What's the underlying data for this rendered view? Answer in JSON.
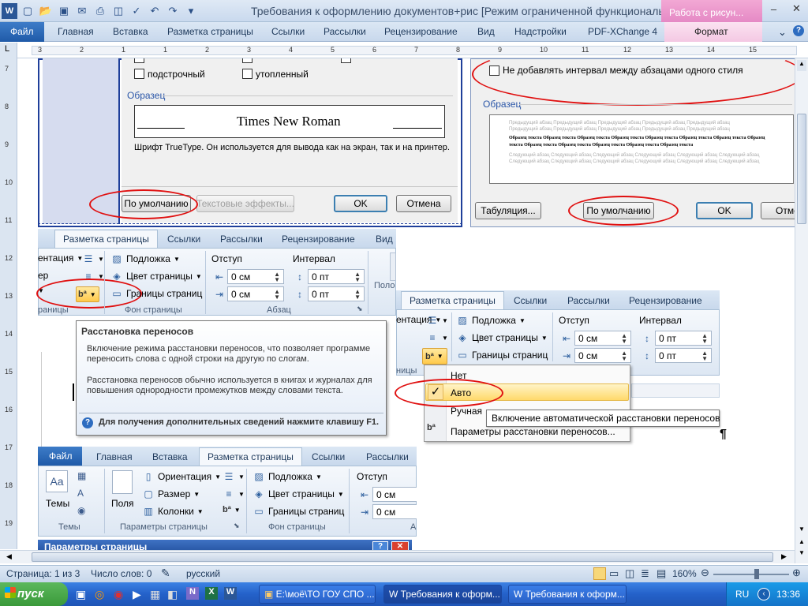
{
  "window": {
    "title": "Требования к оформлению документов+рис [Режим ограниченной функциональн...",
    "context_tab": "Работа с рисун...",
    "format_tab": "Формат"
  },
  "ribbon_tabs": [
    "Файл",
    "Главная",
    "Вставка",
    "Разметка страницы",
    "Ссылки",
    "Рассылки",
    "Рецензирование",
    "Вид",
    "Надстройки",
    "PDF-XChange 4"
  ],
  "font_dialog": {
    "effects": [
      "подстрочный",
      "утопленный"
    ],
    "sample_group": "Образец",
    "sample_text": "Times New Roman",
    "font_note": "Шрифт TrueType. Он используется для вывода как на экран, так и на принтер.",
    "btn_default": "По умолчанию",
    "btn_text_effects": "Текстовые эффекты...",
    "btn_ok": "OK",
    "btn_cancel": "Отмена"
  },
  "paragraph_dialog": {
    "no_spacing_label": "Не добавлять интервал между абзацами одного стиля",
    "sample_group": "Образец",
    "preview_prev": "Предыдущий абзац Предыдущий абзац Предыдущий абзац Предыдущий абзац Предыдущий абзац",
    "preview_sample": "Образец текста Образец текста Образец текста Образец текста Образец текста Образец текста Образец текста Образец текста Образец текста Образец текста Образец текста Образец текста Образец текста",
    "preview_next": "Следующий абзац Следующий абзац Следующий абзац Следующий абзац Следующий абзац Следующий абзац",
    "btn_tabs": "Табуляция...",
    "btn_default": "По умолчанию",
    "btn_ok": "OK",
    "btn_cancel": "Отме"
  },
  "ribbon1": {
    "tabs": [
      "Разметка страницы",
      "Ссылки",
      "Рассылки",
      "Рецензирование",
      "Вид"
    ],
    "orientation": "ентация",
    "fields": "ер",
    "page_bg_items": [
      "Подложка",
      "Цвет страницы",
      "Границы страниц"
    ],
    "page_bg_group": "Фон страницы",
    "indent_label": "Отступ",
    "interval_label": "Интервал",
    "indent_vals": [
      "0 см",
      "0 см"
    ],
    "interval_vals": [
      "0 пт",
      "0 пт"
    ],
    "para_group": "Абзац",
    "params_group": "раницы",
    "pos_label": "Поло"
  },
  "tooltip": {
    "title": "Расстановка переносов",
    "p1": "Включение режима расстановки переносов, что позволяет программе переносить слова с одной строки на другую по слогам.",
    "p2": "Расстановка переносов обычно используется в книгах и журналах для повышения однородности промежутков между словами текста.",
    "help": "Для получения дополнительных сведений нажмите клавишу F1."
  },
  "ribbon2": {
    "tabs": [
      "Разметка страницы",
      "Ссылки",
      "Рассылки",
      "Рецензирование"
    ],
    "orientation": "ентация",
    "page_bg_items": [
      "Подложка",
      "Цвет страницы",
      "Границы страниц"
    ],
    "indent_label": "Отступ",
    "interval_label": "Интервал",
    "indent_vals": [
      "0 см",
      "0 см"
    ],
    "interval_vals": [
      "0 пт",
      "0 пт"
    ],
    "group_frag": "ницы"
  },
  "hyphen_menu": {
    "items": [
      "Нет",
      "Авто",
      "Ручная",
      "Параметры расстановки переносов..."
    ],
    "tip": "Включение автоматической расстановки переносов"
  },
  "ribbon3": {
    "tabs": [
      "Файл",
      "Главная",
      "Вставка",
      "Разметка страницы",
      "Ссылки",
      "Рассылки"
    ],
    "themes": "Темы",
    "themes_group": "Темы",
    "fields": "Поля",
    "page_setup_items": [
      "Ориентация",
      "Размер",
      "Колонки"
    ],
    "page_setup_group": "Параметры страницы",
    "page_bg_items": [
      "Подложка",
      "Цвет страницы",
      "Границы страниц"
    ],
    "page_bg_group": "Фон страницы",
    "indent_label": "Отступ",
    "indent_vals": [
      "0 см",
      "0 см"
    ],
    "group_frag": "А",
    "dialog_title": "Параметры страницы"
  },
  "statusbar": {
    "page": "Страница: 1 из 3",
    "words": "Число слов: 0",
    "language": "русский",
    "zoom": "160%"
  },
  "taskbar": {
    "start": "пуск",
    "tasks": [
      "E:\\моё\\ТО ГОУ СПО ...",
      "Требования к оформ...",
      "Требования к оформ..."
    ],
    "lang": "RU",
    "clock": "13:36"
  },
  "pilcrow": "¶",
  "ruler_nums": [
    "3",
    "2",
    "1",
    "1",
    "2",
    "3",
    "4",
    "5",
    "6",
    "7",
    "8",
    "9",
    "10",
    "11",
    "12",
    "13",
    "14",
    "15"
  ],
  "vruler_nums": [
    "7",
    "8",
    "9",
    "10",
    "11",
    "12",
    "13",
    "14",
    "15",
    "16",
    "17",
    "18",
    "19"
  ]
}
